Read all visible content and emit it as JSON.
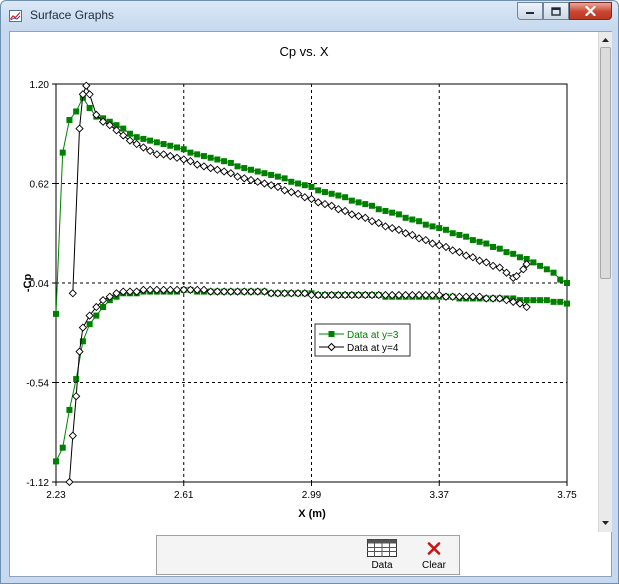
{
  "window": {
    "title": "Surface Graphs"
  },
  "toolbar": {
    "data_label": "Data",
    "clear_label": "Clear"
  },
  "chart_data": {
    "type": "line",
    "title": "Cp vs. X",
    "xlabel": "X (m)",
    "ylabel": "-Cp",
    "xlim": [
      2.23,
      3.75
    ],
    "ylim": [
      -1.12,
      1.2
    ],
    "xticks": [
      "2.23",
      "2.61",
      "2.99",
      "3.37",
      "3.75"
    ],
    "yticks": [
      "1.20",
      "0.62",
      "0.04",
      "-0.54",
      "-1.12"
    ],
    "grid": true,
    "legend_position": "center-right",
    "series": [
      {
        "name": "Data at y=3",
        "color": "#008000",
        "marker": "filled-square",
        "upper": [
          [
            2.23,
            -0.14
          ],
          [
            2.25,
            0.8
          ],
          [
            2.27,
            0.99
          ],
          [
            2.29,
            1.04
          ],
          [
            2.31,
            1.12
          ],
          [
            2.33,
            1.06
          ],
          [
            2.35,
            1.01
          ],
          [
            2.37,
            1.0
          ],
          [
            2.39,
            0.98
          ],
          [
            2.41,
            0.96
          ],
          [
            2.43,
            0.94
          ],
          [
            2.45,
            0.91
          ],
          [
            2.47,
            0.89
          ],
          [
            2.49,
            0.88
          ],
          [
            2.51,
            0.87
          ],
          [
            2.53,
            0.86
          ],
          [
            2.55,
            0.85
          ],
          [
            2.57,
            0.84
          ],
          [
            2.59,
            0.83
          ],
          [
            2.61,
            0.82
          ],
          [
            2.63,
            0.8
          ],
          [
            2.65,
            0.79
          ],
          [
            2.67,
            0.78
          ],
          [
            2.69,
            0.77
          ],
          [
            2.71,
            0.76
          ],
          [
            2.73,
            0.75
          ],
          [
            2.75,
            0.74
          ],
          [
            2.77,
            0.72
          ],
          [
            2.79,
            0.71
          ],
          [
            2.81,
            0.7
          ],
          [
            2.83,
            0.69
          ],
          [
            2.85,
            0.68
          ],
          [
            2.87,
            0.67
          ],
          [
            2.89,
            0.66
          ],
          [
            2.91,
            0.65
          ],
          [
            2.93,
            0.63
          ],
          [
            2.95,
            0.62
          ],
          [
            2.97,
            0.61
          ],
          [
            2.99,
            0.6
          ],
          [
            3.01,
            0.58
          ],
          [
            3.03,
            0.57
          ],
          [
            3.05,
            0.56
          ],
          [
            3.07,
            0.55
          ],
          [
            3.09,
            0.54
          ],
          [
            3.11,
            0.52
          ],
          [
            3.13,
            0.51
          ],
          [
            3.15,
            0.5
          ],
          [
            3.17,
            0.49
          ],
          [
            3.19,
            0.47
          ],
          [
            3.21,
            0.46
          ],
          [
            3.23,
            0.45
          ],
          [
            3.25,
            0.44
          ],
          [
            3.27,
            0.42
          ],
          [
            3.29,
            0.41
          ],
          [
            3.31,
            0.4
          ],
          [
            3.33,
            0.38
          ],
          [
            3.35,
            0.37
          ],
          [
            3.37,
            0.36
          ],
          [
            3.39,
            0.35
          ],
          [
            3.41,
            0.33
          ],
          [
            3.43,
            0.32
          ],
          [
            3.45,
            0.31
          ],
          [
            3.47,
            0.29
          ],
          [
            3.49,
            0.28
          ],
          [
            3.51,
            0.27
          ],
          [
            3.53,
            0.25
          ],
          [
            3.55,
            0.24
          ],
          [
            3.57,
            0.22
          ],
          [
            3.59,
            0.21
          ],
          [
            3.61,
            0.19
          ],
          [
            3.63,
            0.18
          ],
          [
            3.65,
            0.16
          ],
          [
            3.67,
            0.14
          ],
          [
            3.69,
            0.12
          ],
          [
            3.71,
            0.1
          ],
          [
            3.73,
            0.06
          ],
          [
            3.75,
            0.04
          ]
        ],
        "lower": [
          [
            2.23,
            -1.0
          ],
          [
            2.25,
            -0.92
          ],
          [
            2.27,
            -0.7
          ],
          [
            2.29,
            -0.52
          ],
          [
            2.31,
            -0.3
          ],
          [
            2.33,
            -0.2
          ],
          [
            2.35,
            -0.15
          ],
          [
            2.37,
            -0.1
          ],
          [
            2.39,
            -0.06
          ],
          [
            2.41,
            -0.04
          ],
          [
            2.43,
            -0.02
          ],
          [
            2.45,
            -0.02
          ],
          [
            2.47,
            -0.02
          ],
          [
            2.49,
            -0.01
          ],
          [
            2.51,
            -0.01
          ],
          [
            2.53,
            -0.01
          ],
          [
            2.55,
            -0.01
          ],
          [
            2.57,
            -0.01
          ],
          [
            2.59,
            -0.01
          ],
          [
            2.61,
            0.0
          ],
          [
            2.63,
            0.0
          ],
          [
            2.65,
            -0.01
          ],
          [
            2.67,
            -0.01
          ],
          [
            2.69,
            -0.01
          ],
          [
            2.71,
            -0.01
          ],
          [
            2.73,
            -0.01
          ],
          [
            2.75,
            -0.01
          ],
          [
            2.77,
            -0.01
          ],
          [
            2.79,
            -0.01
          ],
          [
            2.81,
            -0.01
          ],
          [
            2.83,
            -0.01
          ],
          [
            2.85,
            -0.01
          ],
          [
            2.87,
            -0.02
          ],
          [
            2.89,
            -0.02
          ],
          [
            2.91,
            -0.02
          ],
          [
            2.93,
            -0.02
          ],
          [
            2.95,
            -0.02
          ],
          [
            2.97,
            -0.02
          ],
          [
            2.99,
            -0.02
          ],
          [
            3.01,
            -0.03
          ],
          [
            3.03,
            -0.03
          ],
          [
            3.05,
            -0.03
          ],
          [
            3.07,
            -0.03
          ],
          [
            3.09,
            -0.03
          ],
          [
            3.11,
            -0.03
          ],
          [
            3.13,
            -0.03
          ],
          [
            3.15,
            -0.03
          ],
          [
            3.17,
            -0.03
          ],
          [
            3.19,
            -0.03
          ],
          [
            3.21,
            -0.04
          ],
          [
            3.23,
            -0.04
          ],
          [
            3.25,
            -0.04
          ],
          [
            3.27,
            -0.04
          ],
          [
            3.29,
            -0.04
          ],
          [
            3.31,
            -0.04
          ],
          [
            3.33,
            -0.04
          ],
          [
            3.35,
            -0.04
          ],
          [
            3.37,
            -0.04
          ],
          [
            3.39,
            -0.04
          ],
          [
            3.41,
            -0.04
          ],
          [
            3.43,
            -0.05
          ],
          [
            3.45,
            -0.05
          ],
          [
            3.47,
            -0.05
          ],
          [
            3.49,
            -0.05
          ],
          [
            3.51,
            -0.05
          ],
          [
            3.53,
            -0.05
          ],
          [
            3.55,
            -0.05
          ],
          [
            3.57,
            -0.05
          ],
          [
            3.59,
            -0.05
          ],
          [
            3.61,
            -0.06
          ],
          [
            3.63,
            -0.06
          ],
          [
            3.65,
            -0.06
          ],
          [
            3.67,
            -0.06
          ],
          [
            3.69,
            -0.06
          ],
          [
            3.71,
            -0.07
          ],
          [
            3.73,
            -0.07
          ],
          [
            3.75,
            -0.08
          ]
        ]
      },
      {
        "name": "Data at y=4",
        "color": "#000000",
        "marker": "hollow-diamond",
        "upper": [
          [
            2.28,
            -0.02
          ],
          [
            2.3,
            0.94
          ],
          [
            2.31,
            1.14
          ],
          [
            2.32,
            1.19
          ],
          [
            2.33,
            1.14
          ],
          [
            2.35,
            1.02
          ],
          [
            2.37,
            0.98
          ],
          [
            2.39,
            0.96
          ],
          [
            2.41,
            0.93
          ],
          [
            2.43,
            0.9
          ],
          [
            2.45,
            0.87
          ],
          [
            2.47,
            0.85
          ],
          [
            2.49,
            0.83
          ],
          [
            2.51,
            0.81
          ],
          [
            2.53,
            0.79
          ],
          [
            2.55,
            0.79
          ],
          [
            2.57,
            0.78
          ],
          [
            2.59,
            0.77
          ],
          [
            2.61,
            0.76
          ],
          [
            2.63,
            0.75
          ],
          [
            2.65,
            0.73
          ],
          [
            2.67,
            0.72
          ],
          [
            2.69,
            0.71
          ],
          [
            2.71,
            0.7
          ],
          [
            2.73,
            0.69
          ],
          [
            2.75,
            0.68
          ],
          [
            2.77,
            0.66
          ],
          [
            2.79,
            0.65
          ],
          [
            2.81,
            0.64
          ],
          [
            2.83,
            0.63
          ],
          [
            2.85,
            0.62
          ],
          [
            2.87,
            0.61
          ],
          [
            2.89,
            0.6
          ],
          [
            2.91,
            0.58
          ],
          [
            2.93,
            0.57
          ],
          [
            2.95,
            0.56
          ],
          [
            2.97,
            0.54
          ],
          [
            2.99,
            0.53
          ],
          [
            3.01,
            0.51
          ],
          [
            3.03,
            0.5
          ],
          [
            3.05,
            0.49
          ],
          [
            3.07,
            0.47
          ],
          [
            3.09,
            0.46
          ],
          [
            3.11,
            0.44
          ],
          [
            3.13,
            0.43
          ],
          [
            3.15,
            0.42
          ],
          [
            3.17,
            0.4
          ],
          [
            3.19,
            0.39
          ],
          [
            3.21,
            0.37
          ],
          [
            3.23,
            0.36
          ],
          [
            3.25,
            0.35
          ],
          [
            3.27,
            0.33
          ],
          [
            3.29,
            0.32
          ],
          [
            3.31,
            0.3
          ],
          [
            3.33,
            0.29
          ],
          [
            3.35,
            0.27
          ],
          [
            3.37,
            0.26
          ],
          [
            3.39,
            0.25
          ],
          [
            3.41,
            0.23
          ],
          [
            3.43,
            0.22
          ],
          [
            3.45,
            0.2
          ],
          [
            3.47,
            0.19
          ],
          [
            3.49,
            0.17
          ],
          [
            3.51,
            0.16
          ],
          [
            3.53,
            0.14
          ],
          [
            3.55,
            0.13
          ],
          [
            3.57,
            0.1
          ],
          [
            3.59,
            0.07
          ],
          [
            3.6,
            0.08
          ],
          [
            3.62,
            0.12
          ],
          [
            3.63,
            0.15
          ]
        ],
        "lower": [
          [
            2.27,
            -1.12
          ],
          [
            2.28,
            -0.85
          ],
          [
            2.29,
            -0.62
          ],
          [
            2.3,
            -0.36
          ],
          [
            2.31,
            -0.22
          ],
          [
            2.33,
            -0.15
          ],
          [
            2.35,
            -0.1
          ],
          [
            2.37,
            -0.06
          ],
          [
            2.39,
            -0.04
          ],
          [
            2.41,
            -0.02
          ],
          [
            2.43,
            -0.01
          ],
          [
            2.45,
            -0.01
          ],
          [
            2.47,
            -0.01
          ],
          [
            2.49,
            0.0
          ],
          [
            2.51,
            0.0
          ],
          [
            2.53,
            0.0
          ],
          [
            2.55,
            0.0
          ],
          [
            2.57,
            0.0
          ],
          [
            2.59,
            0.0
          ],
          [
            2.61,
            0.0
          ],
          [
            2.63,
            0.0
          ],
          [
            2.65,
            0.0
          ],
          [
            2.67,
            0.0
          ],
          [
            2.69,
            -0.01
          ],
          [
            2.71,
            -0.01
          ],
          [
            2.73,
            -0.01
          ],
          [
            2.75,
            -0.01
          ],
          [
            2.77,
            -0.01
          ],
          [
            2.79,
            -0.01
          ],
          [
            2.81,
            -0.01
          ],
          [
            2.83,
            -0.01
          ],
          [
            2.85,
            -0.01
          ],
          [
            2.87,
            -0.02
          ],
          [
            2.89,
            -0.02
          ],
          [
            2.91,
            -0.02
          ],
          [
            2.93,
            -0.02
          ],
          [
            2.95,
            -0.02
          ],
          [
            2.97,
            -0.02
          ],
          [
            2.99,
            -0.03
          ],
          [
            3.01,
            -0.03
          ],
          [
            3.03,
            -0.03
          ],
          [
            3.05,
            -0.03
          ],
          [
            3.07,
            -0.03
          ],
          [
            3.09,
            -0.03
          ],
          [
            3.11,
            -0.03
          ],
          [
            3.13,
            -0.03
          ],
          [
            3.15,
            -0.03
          ],
          [
            3.17,
            -0.03
          ],
          [
            3.19,
            -0.03
          ],
          [
            3.21,
            -0.03
          ],
          [
            3.23,
            -0.03
          ],
          [
            3.25,
            -0.03
          ],
          [
            3.27,
            -0.03
          ],
          [
            3.29,
            -0.03
          ],
          [
            3.31,
            -0.03
          ],
          [
            3.33,
            -0.03
          ],
          [
            3.35,
            -0.03
          ],
          [
            3.37,
            -0.03
          ],
          [
            3.39,
            -0.04
          ],
          [
            3.41,
            -0.04
          ],
          [
            3.43,
            -0.04
          ],
          [
            3.45,
            -0.04
          ],
          [
            3.47,
            -0.04
          ],
          [
            3.49,
            -0.04
          ],
          [
            3.51,
            -0.05
          ],
          [
            3.53,
            -0.05
          ],
          [
            3.55,
            -0.05
          ],
          [
            3.57,
            -0.06
          ],
          [
            3.59,
            -0.07
          ],
          [
            3.61,
            -0.08
          ],
          [
            3.63,
            -0.1
          ]
        ]
      }
    ]
  }
}
